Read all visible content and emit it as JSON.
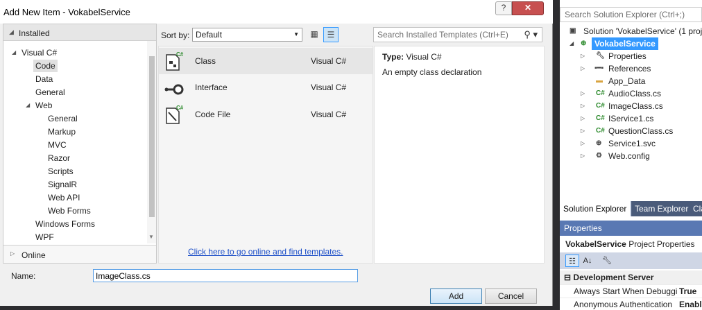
{
  "dialog": {
    "title": "Add New Item - VokabelService",
    "help_label": "?",
    "close_label": "✕"
  },
  "left_pane": {
    "installed_label": "Installed",
    "online_label": "Online",
    "tree": [
      {
        "label": "Visual C#",
        "level": 0,
        "expanded": true
      },
      {
        "label": "Code",
        "level": 1,
        "selected": true
      },
      {
        "label": "Data",
        "level": 1
      },
      {
        "label": "General",
        "level": 1
      },
      {
        "label": "Web",
        "level": 1,
        "expanded": true
      },
      {
        "label": "General",
        "level": 2
      },
      {
        "label": "Markup",
        "level": 2
      },
      {
        "label": "MVC",
        "level": 2
      },
      {
        "label": "Razor",
        "level": 2
      },
      {
        "label": "Scripts",
        "level": 2
      },
      {
        "label": "SignalR",
        "level": 2
      },
      {
        "label": "Web API",
        "level": 2
      },
      {
        "label": "Web Forms",
        "level": 2
      },
      {
        "label": "Windows Forms",
        "level": 1
      },
      {
        "label": "WPF",
        "level": 1
      }
    ]
  },
  "toolbar": {
    "sort_label": "Sort by:",
    "sort_value": "Default",
    "search_placeholder": "Search Installed Templates (Ctrl+E)"
  },
  "templates": [
    {
      "name": "Class",
      "language": "Visual C#",
      "icon": "class-icon",
      "selected": true
    },
    {
      "name": "Interface",
      "language": "Visual C#",
      "icon": "interface-icon"
    },
    {
      "name": "Code File",
      "language": "Visual C#",
      "icon": "code-file-icon"
    }
  ],
  "online_link": "Click here to go online and find templates.",
  "details": {
    "type_label": "Type:",
    "type_value": "Visual C#",
    "description": "An empty class declaration"
  },
  "name_field": {
    "label": "Name:",
    "value": "ImageClass.cs"
  },
  "buttons": {
    "add": "Add",
    "cancel": "Cancel"
  },
  "solution_explorer": {
    "search_placeholder": "Search Solution Explorer (Ctrl+;)",
    "items": [
      {
        "label": "Solution 'VokabelService' (1 proj",
        "icon": "solution-icon"
      },
      {
        "label": "VokabelService",
        "icon": "web-project-icon",
        "selected": true
      },
      {
        "label": "Properties",
        "icon": "wrench-icon"
      },
      {
        "label": "References",
        "icon": "references-icon"
      },
      {
        "label": "App_Data",
        "icon": "folder-icon"
      },
      {
        "label": "AudioClass.cs",
        "icon": "csharp-file-icon"
      },
      {
        "label": "ImageClass.cs",
        "icon": "csharp-file-icon"
      },
      {
        "label": "IService1.cs",
        "icon": "csharp-file-icon"
      },
      {
        "label": "QuestionClass.cs",
        "icon": "csharp-file-icon"
      },
      {
        "label": "Service1.svc",
        "icon": "globe-icon"
      },
      {
        "label": "Web.config",
        "icon": "config-icon"
      }
    ],
    "tabs": [
      "Solution Explorer",
      "Team Explorer",
      "Cla"
    ]
  },
  "properties": {
    "header": "Properties",
    "object_name": "VokabelService",
    "object_type": "Project Properties",
    "category": "Development Server",
    "rows": [
      {
        "key": "Always Start When Debuggi",
        "value": "True"
      },
      {
        "key": "Anonymous Authentication",
        "value": "Enable"
      }
    ]
  },
  "colors": {
    "selection_blue": "#3399ff",
    "link_blue": "#1e50c8",
    "properties_header": "#5978b3",
    "close_red": "#c75050"
  }
}
